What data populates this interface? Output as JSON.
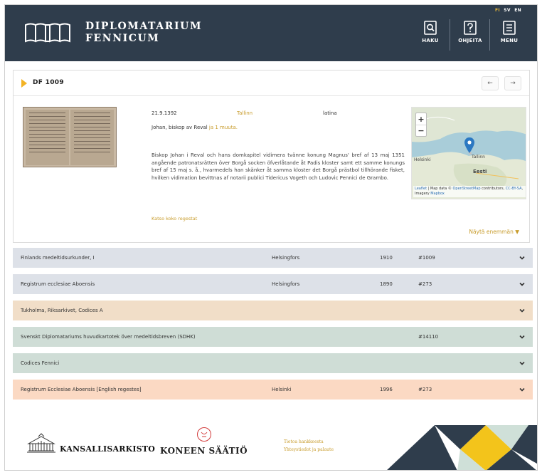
{
  "header": {
    "logo_line1": "DIPLOMATARIUM",
    "logo_line2": "FENNICUM",
    "languages": [
      "FI",
      "SV",
      "EN"
    ],
    "active_language": "FI",
    "nav": [
      {
        "label": "HAKU",
        "icon": "search-document-icon"
      },
      {
        "label": "OHJEITA",
        "icon": "help-document-icon"
      },
      {
        "label": "MENU",
        "icon": "menu-document-icon"
      }
    ],
    "colors": {
      "background": "#2f3d4c",
      "accent": "#e2b53b"
    }
  },
  "document": {
    "id": "DF 1009",
    "prev_label": "←",
    "next_label": "→",
    "date": "21.9.1392",
    "place": "Tallinn",
    "language": "latina",
    "author_text": "Johan, biskop av Reval",
    "author_link": "ja 1 muuta.",
    "regest": "Biskop Johan i Reval och hans domkapitel vidimera tvänne konung Magnus' bref af 13 maj 1351 angående patronatsrätten över Borgå socken öfverlåtande åt Padis kloster samt ett samme konungs bref af 15 maj s. å., hvarmedels han skänker åt samma kloster det Borgå prästbol tillhörande fisket, hvilken vidimation bevittnas af notarii publici Tidericus Vogeth och Ludovic Pennici de Grambo.",
    "regest_link": "Katso koko regestat",
    "show_more": "Näytä enemmän ▼",
    "map": {
      "zoom_in": "+",
      "zoom_out": "−",
      "label_country": "Eesti",
      "label_city": "Tallinn",
      "label_sea": "Helsinki",
      "attribution_prefix": "Leaflet",
      "attribution_mid": " | Map data © ",
      "attribution_osm": "OpenStreetMap",
      "attribution_tail": " contributors, ",
      "attribution_cc": "CC-BY-SA",
      "attribution_end": ", Imagery ",
      "attribution_mapbox": "Mapbox"
    }
  },
  "sources": [
    {
      "title": "Finlands medeltidsurkunder, I",
      "place": "Helsingfors",
      "year": "1910",
      "number": "#1009",
      "color": "#dde1e8"
    },
    {
      "title": "Registrum ecclesiae Aboensis",
      "place": "Helsingfors",
      "year": "1890",
      "number": "#273",
      "color": "#dde1e8"
    },
    {
      "title": "Tukholma, Riksarkivet, Codices A",
      "place": "",
      "year": "",
      "number": "",
      "color": "#f1dec8"
    },
    {
      "title": "Svenskt Diplomatariums huvudkartotek över medeltidsbreven (SDHK)",
      "place": "",
      "year": "",
      "number": "#14110",
      "color": "#cfddd6"
    },
    {
      "title": "Codices Fennici",
      "place": "",
      "year": "",
      "number": "",
      "color": "#cfddd6"
    },
    {
      "title": "Registrum Ecclesiae Aboensis [English regestes]",
      "place": "Helsinki",
      "year": "1996",
      "number": "#273",
      "color": "#fbd9c3"
    }
  ],
  "footer": {
    "kansallisarkisto": "KANSALLISARKISTO",
    "koneen_saatio": "KONEEN SÄÄTIÖ",
    "link_info": "Tietoa hankkeesta",
    "link_contact": "Yhteystiedot ja palaute"
  }
}
